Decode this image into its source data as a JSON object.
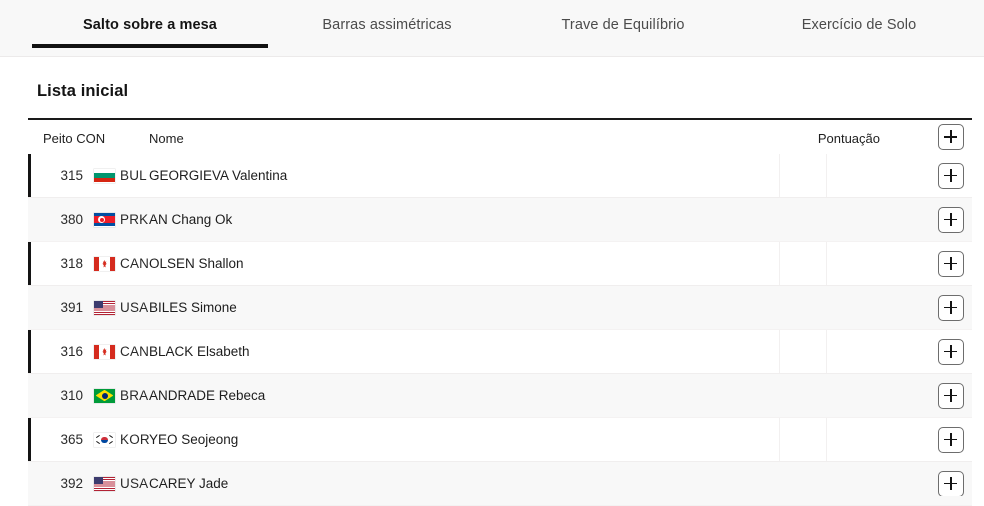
{
  "tabs": [
    {
      "label": "Salto sobre a mesa",
      "active": true,
      "center": 150
    },
    {
      "label": "Barras assimétricas",
      "active": false,
      "center": 387
    },
    {
      "label": "Trave de Equilíbrio",
      "active": false,
      "center": 623
    },
    {
      "label": "Exercício de Solo",
      "active": false,
      "center": 859
    }
  ],
  "section": {
    "title": "Lista inicial"
  },
  "table": {
    "headers": {
      "bib": "Peito CON",
      "name": "Nome",
      "score": "Pontuação"
    },
    "add_button_label": "+",
    "rows": [
      {
        "bib": "315",
        "noc": "BUL",
        "name": "GEORGIEVA Valentina",
        "score": "",
        "marked": true,
        "alt": false
      },
      {
        "bib": "380",
        "noc": "PRK",
        "name": "AN Chang Ok",
        "score": "",
        "marked": false,
        "alt": true
      },
      {
        "bib": "318",
        "noc": "CAN",
        "name": "OLSEN Shallon",
        "score": "",
        "marked": true,
        "alt": false
      },
      {
        "bib": "391",
        "noc": "USA",
        "name": "BILES Simone",
        "score": "",
        "marked": false,
        "alt": true
      },
      {
        "bib": "316",
        "noc": "CAN",
        "name": "BLACK Elsabeth",
        "score": "",
        "marked": true,
        "alt": false
      },
      {
        "bib": "310",
        "noc": "BRA",
        "name": "ANDRADE Rebeca",
        "score": "",
        "marked": false,
        "alt": true
      },
      {
        "bib": "365",
        "noc": "KOR",
        "name": "YEO Seojeong",
        "score": "",
        "marked": true,
        "alt": false
      },
      {
        "bib": "392",
        "noc": "USA",
        "name": "CAREY Jade",
        "score": "",
        "marked": false,
        "alt": true
      }
    ]
  },
  "colors": {
    "accent": "#121212",
    "page_bg": "#ffffff",
    "tabbar_bg": "#f8f8f8",
    "alt_row_bg": "#f8f8f8",
    "text": "#1a1a1a"
  }
}
